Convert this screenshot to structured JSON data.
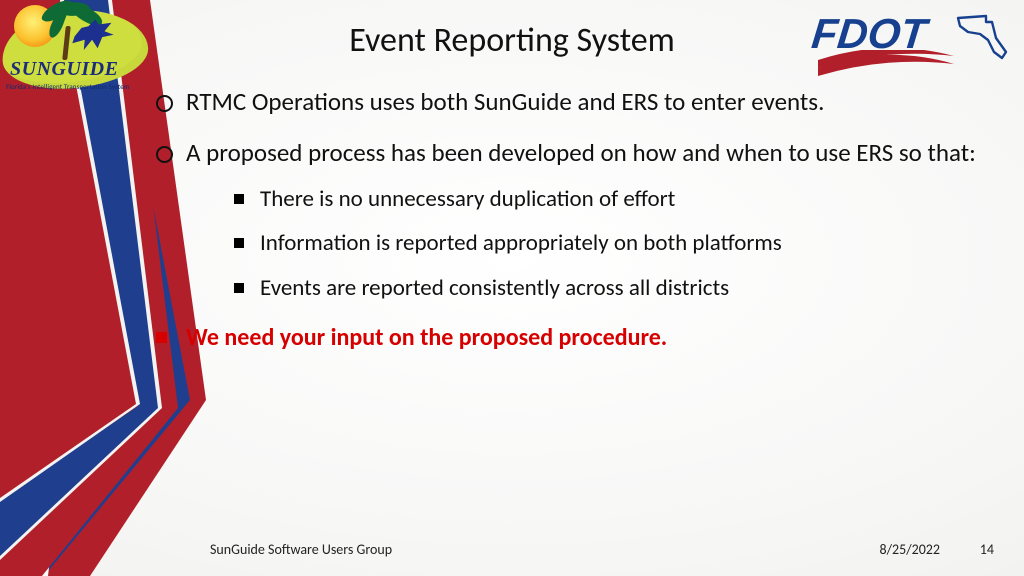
{
  "title": "Event Reporting System",
  "logos": {
    "sunguide_brand": "SUNGUIDE",
    "sunguide_tag": "Florida's Intelligent Transportation System",
    "fdot_word": "FDOT"
  },
  "bullets": {
    "o1": "RTMC Operations uses both SunGuide and ERS to enter events.",
    "o2": "A proposed process has been developed on how and when to use ERS so that:",
    "s1": "There is no unnecessary duplication of effort",
    "s2": "Information is reported appropriately on both platforms",
    "s3": "Events are reported consistently across all districts",
    "hl": "We need your input on the proposed procedure."
  },
  "footer": {
    "group": "SunGuide Software Users Group",
    "date": "8/25/2022",
    "page": "14"
  },
  "colors": {
    "red": "#b1202a",
    "blue": "#1f3e8e",
    "highlight": "#d60000"
  }
}
